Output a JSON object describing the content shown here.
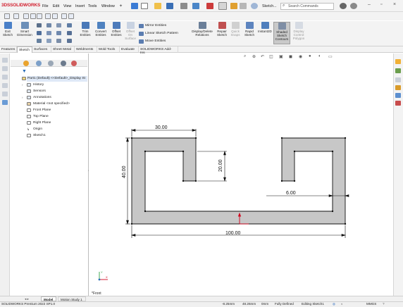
{
  "app": {
    "brand_ds": "3DS",
    "brand_name": "SOLIDWORKS",
    "menus": [
      "File",
      "Edit",
      "View",
      "Insert",
      "Tools",
      "Window"
    ],
    "document_title": "Sketch...",
    "search_placeholder": "Search Commands"
  },
  "ribbon": {
    "exit_sketch": [
      "Exit",
      "Sketch"
    ],
    "smart_dimension": [
      "Smart",
      "Dimension"
    ],
    "trim_entities": [
      "Trim",
      "Entities"
    ],
    "convert_entities": [
      "Convert",
      "Entities"
    ],
    "offset_entities": [
      "Offset",
      "Entities"
    ],
    "offset_on_surface": [
      "Offset",
      "On",
      "Surface"
    ],
    "mirror_entities": "Mirror Entities",
    "linear_sketch_pattern": "Linear Sketch Pattern",
    "move_entities": "Move Entities",
    "display_delete_relations": [
      "Display/Delete",
      "Relations"
    ],
    "repair_sketch": [
      "Repair",
      "Sketch"
    ],
    "quick_snaps": [
      "Quick",
      "Snaps"
    ],
    "rapid_sketch": [
      "Rapid",
      "Sketch"
    ],
    "instant2d": "Instant2D",
    "shaded_sketch_contours": [
      "Shaded",
      "Sketch",
      "Contours"
    ],
    "display_control_polygon": [
      "Display",
      "Control",
      "Polygon"
    ]
  },
  "tabs": [
    "Features",
    "Sketch",
    "Surfaces",
    "Sheet Metal",
    "Weldments",
    "Mold Tools",
    "Evaluate",
    "SOLIDWORKS Add-Ins"
  ],
  "active_tab": "Sketch",
  "tree": {
    "root": "Part1 (Default) <<Default>_Display St",
    "items": [
      "History",
      "Sensors",
      "Annotations",
      "Material <not specified>",
      "Front Plane",
      "Top Plane",
      "Right Plane",
      "Origin",
      "Sketch1"
    ]
  },
  "sketch": {
    "dimensions": {
      "top_width": "30.00",
      "notch_depth": "20.00",
      "height": "40.00",
      "wall": "6.00",
      "overall_width": "100.00"
    },
    "view_label": "*Front"
  },
  "bottom_tabs": [
    "Model",
    "Motion Study 1"
  ],
  "status": {
    "product": "SOLIDWORKS Premium 2022 SP1.0",
    "x": "-8.25mm",
    "y": "48.26mm",
    "z": "0mm",
    "state": "Fully Defined",
    "editing": "Editing Sketch1",
    "units": "MMGS"
  },
  "colors": {
    "fill": "#c7c7c7",
    "accent_blue": "#2a6db8",
    "brand_red": "#d2202f",
    "origin_red": "#d0021b"
  }
}
